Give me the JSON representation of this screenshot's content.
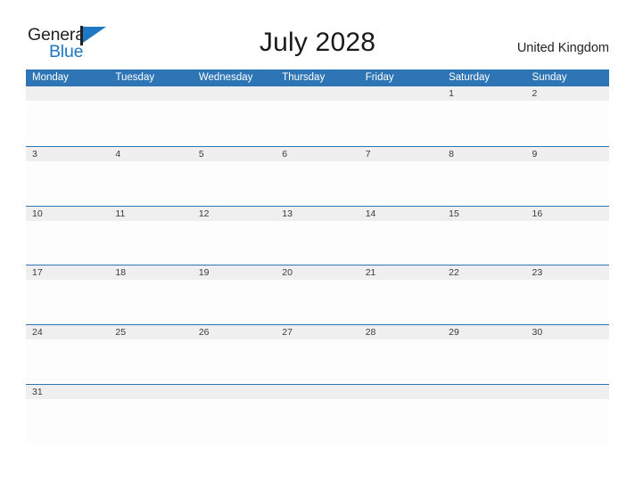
{
  "brand": {
    "name_part1": "General",
    "name_part2": "Blue",
    "flag_icon": "flag-triangle-icon",
    "primary_color": "#2e75b6",
    "logo_blue": "#1f76c2",
    "logo_dark": "#231f20"
  },
  "header": {
    "title": "July 2028",
    "country": "United Kingdom"
  },
  "calendar": {
    "month": "July",
    "year": "2028",
    "header_bg": "#2e75b6",
    "band_bg": "#efefef",
    "cell_bg": "#fdfdfd",
    "divider_color": "#2e75b6",
    "weekdays": [
      "Monday",
      "Tuesday",
      "Wednesday",
      "Thursday",
      "Friday",
      "Saturday",
      "Sunday"
    ],
    "weeks": [
      [
        "",
        "",
        "",
        "",
        "",
        "1",
        "2"
      ],
      [
        "3",
        "4",
        "5",
        "6",
        "7",
        "8",
        "9"
      ],
      [
        "10",
        "11",
        "12",
        "13",
        "14",
        "15",
        "16"
      ],
      [
        "17",
        "18",
        "19",
        "20",
        "21",
        "22",
        "23"
      ],
      [
        "24",
        "25",
        "26",
        "27",
        "28",
        "29",
        "30"
      ],
      [
        "31",
        "",
        "",
        "",
        "",
        "",
        ""
      ]
    ]
  }
}
